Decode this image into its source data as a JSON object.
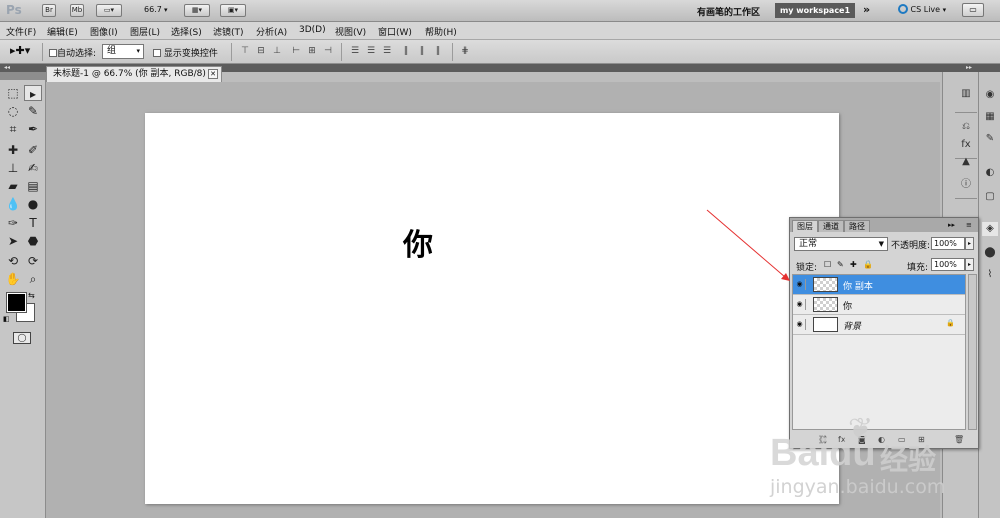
{
  "appbar": {
    "logo": "Ps",
    "btn_br": "Br",
    "btn_mb": "Mb",
    "zoom": "66.7",
    "workspace_label": "有画笔的工作区",
    "workspace_name": "my workspace1",
    "more": "»",
    "cs_live": "CS Live"
  },
  "menu": [
    "文件(F)",
    "编辑(E)",
    "图像(I)",
    "图层(L)",
    "选择(S)",
    "滤镜(T)",
    "分析(A)",
    "3D(D)",
    "视图(V)",
    "窗口(W)",
    "帮助(H)"
  ],
  "options": {
    "auto_select_label": "自动选择:",
    "auto_select_value": "组",
    "show_transform_label": "显示变换控件"
  },
  "document": {
    "tab_title": "未标题-1 @ 66.7% (你 副本, RGB/8) *",
    "canvas_text": "你"
  },
  "layers_panel": {
    "tabs": [
      "图层",
      "通道",
      "路径"
    ],
    "blend_mode": "正常",
    "opacity_label": "不透明度:",
    "opacity_value": "100%",
    "lock_label": "锁定:",
    "fill_label": "填充:",
    "fill_value": "100%",
    "layers": [
      {
        "name": "你 副本",
        "selected": true,
        "thumb": "transparent",
        "locked": false
      },
      {
        "name": "你",
        "selected": false,
        "thumb": "transparent",
        "locked": false
      },
      {
        "name": "背景",
        "selected": false,
        "thumb": "white",
        "locked": true
      }
    ]
  },
  "colors": {
    "selection": "#3f8ee0",
    "annotation_arrow": "#e53030",
    "foreground": "#000000",
    "background": "#ffffff"
  },
  "watermark": {
    "brand": "Baidu",
    "product": "经验",
    "url": "jingyan.baidu.com"
  }
}
